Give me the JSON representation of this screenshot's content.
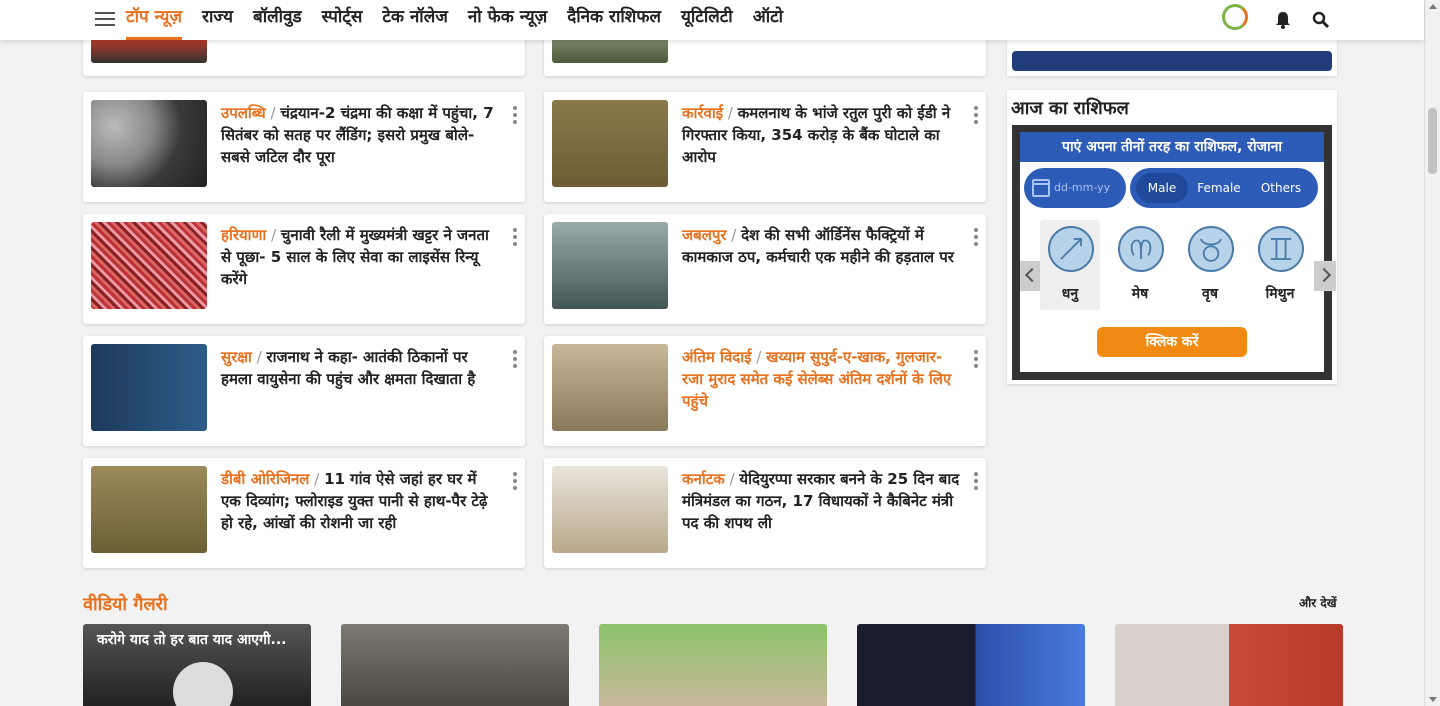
{
  "nav": {
    "items": [
      "टॉप न्यूज़",
      "राज्य",
      "बॉलीवुड",
      "स्पोर्ट्स",
      "टेक नॉलेज",
      "नो फेक न्यूज़",
      "दैनिक राशिफल",
      "यूटिलिटी",
      "ऑटो"
    ],
    "active_index": 0
  },
  "colors": {
    "accent": "#e8711f",
    "rashi_blue": "#2c5cb7",
    "button_orange": "#f08a12"
  },
  "news": [
    {
      "category": "उपलब्धि",
      "headline": "चंद्रयान-2 चंद्रमा की कक्षा में पहुंचा, 7 सितंबर को सतह पर लैंडिंग; इसरो प्रमुख बोले- सबसे जटिल दौर पूरा",
      "orange": false
    },
    {
      "category": "कार्रवाई",
      "headline": "कमलनाथ के भांजे रतुल पुरी को ईडी ने गिरफ्तार किया, 354 करोड़ के बैंक घोटाले का आरोप",
      "orange": false
    },
    {
      "category": "हरियाणा",
      "headline": "चुनावी रैली में मुख्यमंत्री खट्टर ने जनता से पूछा- 5 साल के लिए सेवा का लाइसेंस रिन्यू करेंगे",
      "orange": false
    },
    {
      "category": "जबलपुर",
      "headline": "देश की सभी ऑर्डिनेंस फैक्ट्रियों में कामकाज ठप, कर्मचारी एक महीने की हड़ताल पर",
      "orange": false
    },
    {
      "category": "सुरक्षा",
      "headline": "राजनाथ ने कहा- आतंकी ठिकानों पर हमला वायुसेना की पहुंच और क्षमता दिखाता है",
      "orange": false
    },
    {
      "category": "अंतिम विदाई",
      "headline": "खय्याम सुपुर्द-ए-खाक, गुलजार-रजा मुराद समेत कई सेलेब्स अंतिम दर्शनों के लिए पहुंचे",
      "orange": true
    },
    {
      "category": "डीबी ओरिजिनल",
      "headline": "11 गांव ऐसे जहां हर घर में एक दिव्यांग; फ्लोराइड युक्त पानी से हाथ-पैर टेढ़े हो रहे, आंखों की रोशनी जा रही",
      "orange": false
    },
    {
      "category": "कर्नाटक",
      "headline": "येदियुरप्पा सरकार बनने के 25 दिन बाद मंत्रिमंडल का गठन, 17 विधायकों ने कैबिनेट मंत्री पद की शपथ ली",
      "orange": false
    }
  ],
  "rashifal": {
    "title": "आज का राशिफल",
    "banner": "पाएं अपना तीनों तरह का राशिफल, रोजाना",
    "date_placeholder": "dd-mm-yy",
    "genders": [
      "Male",
      "Female",
      "Others"
    ],
    "selected_gender": "Male",
    "signs": [
      "धनु",
      "मेष",
      "वृष",
      "मिथुन"
    ],
    "selected_sign": "धनु",
    "button": "क्लिक करें"
  },
  "video_gallery": {
    "title": "वीडियो गैलरी",
    "more": "और देखें",
    "first_caption": "करोगे याद तो हर बात याद आएगी..."
  }
}
